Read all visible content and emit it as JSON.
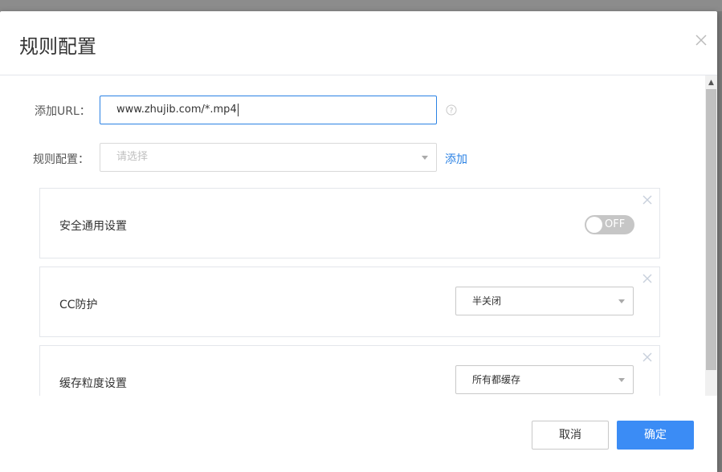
{
  "dialog": {
    "title": "规则配置"
  },
  "form": {
    "url_label": "添加URL：",
    "url_value": "www.zhujib.com/*.mp4",
    "rule_label": "规则配置：",
    "rule_placeholder": "请选择",
    "add_link": "添加"
  },
  "rules": [
    {
      "label": "安全通用设置",
      "control": "toggle",
      "toggle_text": "OFF",
      "toggle_on": false
    },
    {
      "label": "CC防护",
      "control": "select",
      "selected": "半关闭"
    },
    {
      "label": "缓存粒度设置",
      "control": "select",
      "selected": "所有都缓存"
    }
  ],
  "footer": {
    "cancel_label": "取消",
    "ok_label": "确定"
  },
  "colors": {
    "accent": "#2b82e4",
    "primary_button": "#3b8cf5",
    "toggle_off": "#c6c6c6",
    "border": "#e3e6eb"
  },
  "icons": {
    "close": "close-icon",
    "help": "help-circle-icon",
    "dropdown": "chevron-down-icon",
    "scroll_up": "scroll-up-arrow-icon"
  }
}
